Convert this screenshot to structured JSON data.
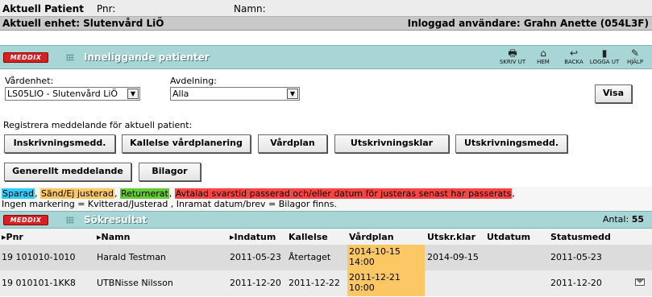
{
  "patient_header": {
    "title": "Aktuell Patient",
    "pnr_label": "Pnr:",
    "namn_label": "Namn:",
    "unit": "Aktuell enhet: Slutenvård LiÖ",
    "user": "Inloggad användare: Grahn Anette (054L3F)"
  },
  "main_panel": {
    "logo": "MEDDIX",
    "title": "Inneliggande patienter",
    "toolbar": [
      {
        "label": "SKRIV UT",
        "icon": "printer-icon",
        "glyph": "🖶"
      },
      {
        "label": "HEM",
        "icon": "home-icon",
        "glyph": "⌂"
      },
      {
        "label": "BACKA",
        "icon": "back-icon",
        "glyph": "↩"
      },
      {
        "label": "LOGGA UT",
        "icon": "logout-icon",
        "glyph": "▮"
      },
      {
        "label": "HJÄLP",
        "icon": "help-icon",
        "glyph": "✎"
      }
    ]
  },
  "filters": {
    "vardenhet_label": "Vårdenhet:",
    "vardenhet_value": "LS05LIO - Slutenvård LiÖ",
    "avdelning_label": "Avdelning:",
    "avdelning_value": "Alla",
    "visa_button": "Visa",
    "register_label": "Registrera meddelande för aktuell patient:",
    "buttons_row1": [
      "Inskrivningsmedd.",
      "Kallelse vårdplanering",
      "Vårdplan",
      "Utskrivningsklar",
      "Utskrivningsmedd."
    ],
    "buttons_row2": [
      "Generellt meddelande",
      "Bilagor"
    ]
  },
  "legend": {
    "sparad": "Sparad",
    "sand": "Sänd/Ej justerad",
    "returnerat": "Returnerat",
    "avtalad": "Avtalad svarstid passerad och/eller datum för justeras senast har passerats",
    "line2": "Ingen markering = Kvitterad/Justerad , Inramat datum/brev = Bilagor finns.",
    "colors": {
      "sparad": "#33ccff",
      "sand": "#fcc865",
      "returnerat": "#66cc33",
      "avtalad": "#ff4444"
    }
  },
  "results": {
    "logo": "MEDDIX",
    "title": "Sökresultat",
    "antal_label": "Antal:",
    "antal_value": "55",
    "columns": [
      "Pnr",
      "Namn",
      "Indatum",
      "Kallelse",
      "Vårdplan",
      "Utskr.klar",
      "Utdatum",
      "Statusmedd"
    ],
    "rows": [
      {
        "pnr": "19 101010-1010",
        "namn": "Harald Testman",
        "indatum": "2011-05-23",
        "kallelse": "Återtaget",
        "vardplan_date": "2014-10-15",
        "vardplan_time": "14:00",
        "utskrklar": "2014-09-15",
        "utdatum": "",
        "statusmedd": "2011-05-23"
      },
      {
        "pnr": "19 010101-1KK8",
        "namn": "UTBNisse Nilsson",
        "indatum": "2011-12-20",
        "kallelse": "2011-12-22",
        "vardplan_date": "2011-12-21",
        "vardplan_time": "10:00",
        "utskrklar": "",
        "utdatum": "",
        "statusmedd": "2011-12-20"
      }
    ]
  }
}
